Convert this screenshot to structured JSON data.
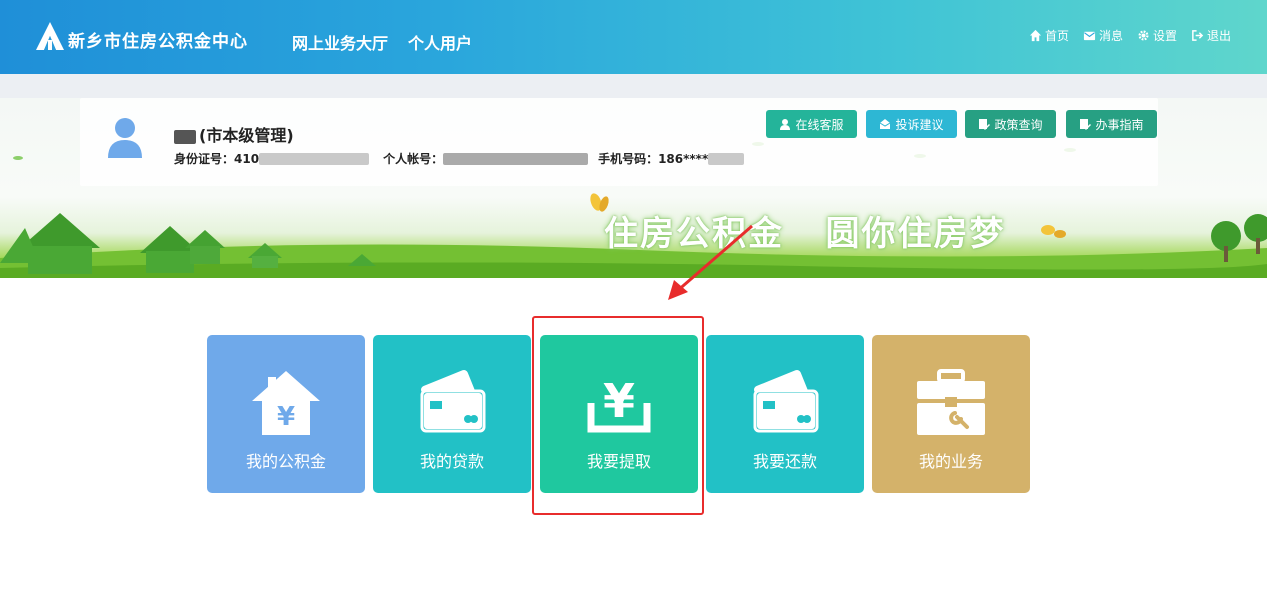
{
  "header": {
    "brand": "新乡市住房公积金中心",
    "nav": [
      "网上业务大厅",
      "个人用户"
    ],
    "menu": [
      {
        "icon": "home-icon",
        "label": "首页"
      },
      {
        "icon": "mail-icon",
        "label": "消息"
      },
      {
        "icon": "gear-icon",
        "label": "设置"
      },
      {
        "icon": "logout-icon",
        "label": "退出"
      }
    ]
  },
  "profile": {
    "name": "(市本级管理)",
    "id_label": "身份证号：410",
    "account_label": "个人帐号：",
    "phone_label": "手机号码：186****"
  },
  "services": [
    {
      "icon": "customer-service-icon",
      "label": "在线客服"
    },
    {
      "icon": "complaint-icon",
      "label": "投诉建议"
    },
    {
      "icon": "policy-icon",
      "label": "政策查询"
    },
    {
      "icon": "guide-icon",
      "label": "办事指南"
    }
  ],
  "banner": {
    "slogan": "住房公积金   圆你住房梦"
  },
  "tiles": [
    {
      "icon": "house-yuan-icon",
      "label": "我的公积金",
      "color": "#6fa9ea"
    },
    {
      "icon": "card-icon",
      "label": "我的贷款",
      "color": "#22c1c6"
    },
    {
      "icon": "yuan-withdraw-icon",
      "label": "我要提取",
      "color": "#1fc89f"
    },
    {
      "icon": "card-icon",
      "label": "我要还款",
      "color": "#22c1c6"
    },
    {
      "icon": "toolbox-icon",
      "label": "我的业务",
      "color": "#d4b26a"
    }
  ],
  "annotation": {
    "color": "#e82c2c"
  }
}
